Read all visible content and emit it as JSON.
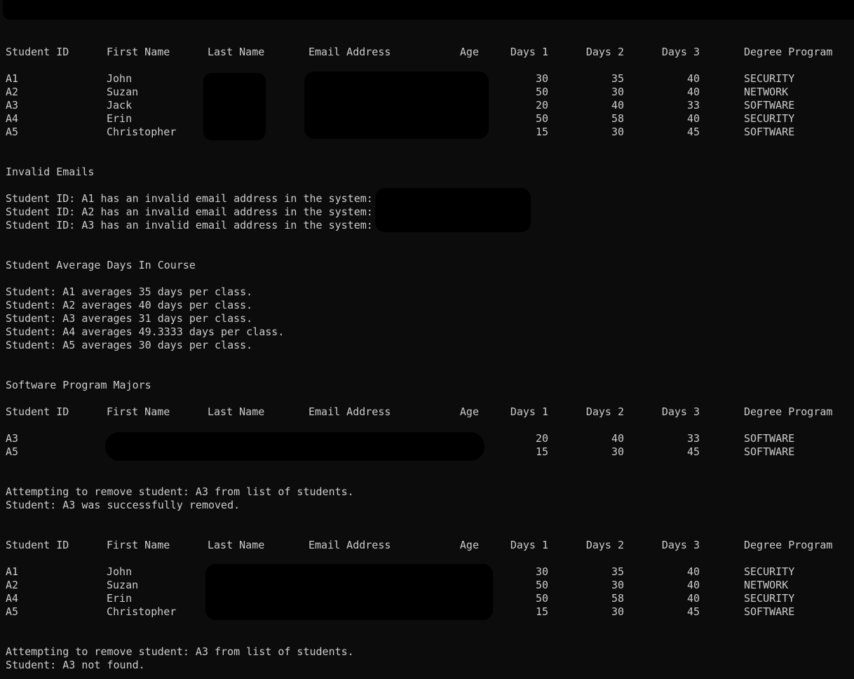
{
  "headers": {
    "student_id": "Student ID",
    "first_name": "First Name",
    "last_name": "Last Name",
    "email": "Email Address",
    "age": "Age",
    "days1": "Days 1",
    "days2": "Days 2",
    "days3": "Days 3",
    "degree": "Degree Program"
  },
  "roster1": [
    {
      "id": "A1",
      "first": "John",
      "d1": "30",
      "d2": "35",
      "d3": "40",
      "degree": "SECURITY"
    },
    {
      "id": "A2",
      "first": "Suzan",
      "d1": "50",
      "d2": "30",
      "d3": "40",
      "degree": "NETWORK"
    },
    {
      "id": "A3",
      "first": "Jack",
      "d1": "20",
      "d2": "40",
      "d3": "33",
      "degree": "SOFTWARE"
    },
    {
      "id": "A4",
      "first": "Erin",
      "d1": "50",
      "d2": "58",
      "d3": "40",
      "degree": "SECURITY"
    },
    {
      "id": "A5",
      "first": "Christopher",
      "d1": "15",
      "d2": "30",
      "d3": "45",
      "degree": "SOFTWARE"
    }
  ],
  "invalid_emails": {
    "title": "Invalid Emails",
    "lines": [
      "Student ID: A1 has an invalid email address in the system:",
      "Student ID: A2 has an invalid email address in the system:",
      "Student ID: A3 has an invalid email address in the system:"
    ]
  },
  "averages": {
    "title": "Student Average Days In Course",
    "lines": [
      "Student: A1 averages 35 days per class.",
      "Student: A2 averages 40 days per class.",
      "Student: A3 averages 31 days per class.",
      "Student: A4 averages 49.3333 days per class.",
      "Student: A5 averages 30 days per class."
    ]
  },
  "software": {
    "title": "Software Program Majors",
    "rows": [
      {
        "id": "A3",
        "d1": "20",
        "d2": "40",
        "d3": "33",
        "degree": "SOFTWARE"
      },
      {
        "id": "A5",
        "d1": "15",
        "d2": "30",
        "d3": "45",
        "degree": "SOFTWARE"
      }
    ]
  },
  "remove1": {
    "attempt": "Attempting to remove student: A3 from list of students.",
    "result": "Student: A3 was successfully removed."
  },
  "roster2": [
    {
      "id": "A1",
      "first": "John",
      "d1": "30",
      "d2": "35",
      "d3": "40",
      "degree": "SECURITY"
    },
    {
      "id": "A2",
      "first": "Suzan",
      "d1": "50",
      "d2": "30",
      "d3": "40",
      "degree": "NETWORK"
    },
    {
      "id": "A4",
      "first": "Erin",
      "d1": "50",
      "d2": "58",
      "d3": "40",
      "degree": "SECURITY"
    },
    {
      "id": "A5",
      "first": "Christopher",
      "d1": "15",
      "d2": "30",
      "d3": "45",
      "degree": "SOFTWARE"
    }
  ],
  "remove2": {
    "attempt": "Attempting to remove student: A3 from list of students.",
    "result": "Student: A3 not found."
  }
}
